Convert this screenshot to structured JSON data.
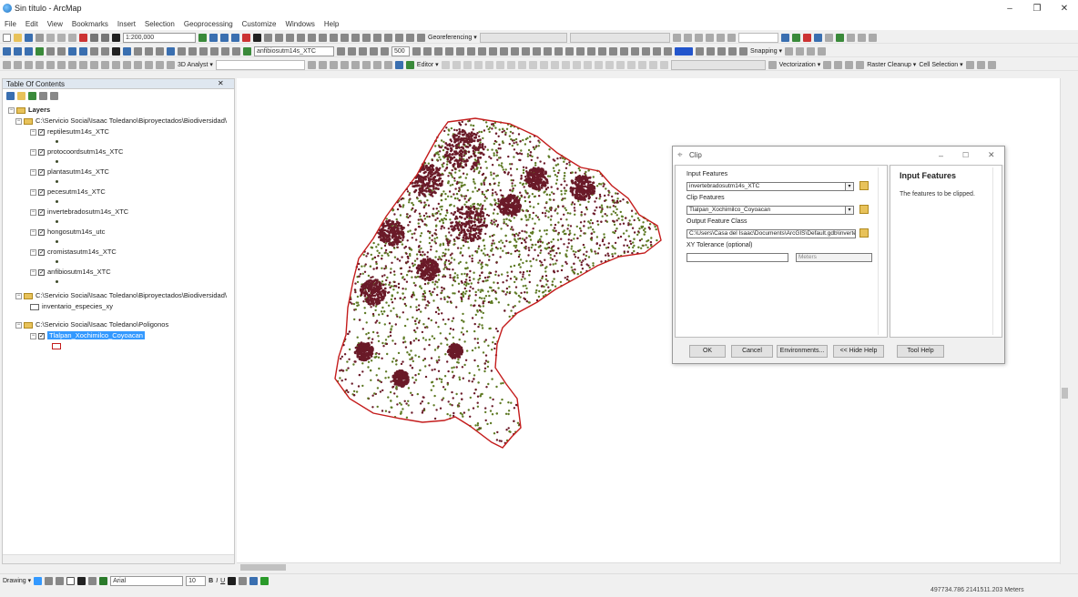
{
  "window": {
    "title": "Sin título - ArcMap",
    "minimize": "–",
    "maximize": "❐",
    "close": "✕"
  },
  "menu": [
    "File",
    "Edit",
    "View",
    "Bookmarks",
    "Insert",
    "Selection",
    "Geoprocessing",
    "Customize",
    "Windows",
    "Help"
  ],
  "toolbar": {
    "scale": "1:200,000",
    "georeferencing": "Georeferencing ▾",
    "layer_combo": "anfibiosutm14s_XTC",
    "pct": "500",
    "snapping": "Snapping ▾",
    "analyst_3d": "3D Analyst ▾",
    "editor": "Editor ▾",
    "vectorization": "Vectorization ▾",
    "raster_cleanup": "Raster Cleanup ▾",
    "cell_selection": "Cell Selection ▾"
  },
  "toc": {
    "title": "Table Of Contents",
    "close": "✕",
    "layers_label": "Layers",
    "folder1": "C:\\Servicio Social\\Isaac Toledano\\Biproyectados\\Biodiversidad\\",
    "layers": [
      "reptilesutm14s_XTC",
      "protocoordsutm14s_XTC",
      "plantasutm14s_XTC",
      "pecesutm14s_XTC",
      "invertebradosutm14s_XTC",
      "hongosutm14s_utc",
      "cromistasutm14s_XTC",
      "anfibiosutm14s_XTC"
    ],
    "folder2": "C:\\Servicio Social\\Isaac Toledano\\Biproyectados\\Biodiversidad\\",
    "folder2_layer": "inventario_especies_xy",
    "folder3": "C:\\Servicio Social\\Isaac Toledano\\Poligonos",
    "selected_layer": "Tlalpan_Xochimilco_Coyoacan"
  },
  "clip": {
    "title": "Clip",
    "input_features_label": "Input Features",
    "input_features_value": "invertebradosutm14s_XTC",
    "clip_features_label": "Clip Features",
    "clip_features_value": "Tlalpan_Xochimilco_Coyoacan",
    "output_label": "Output Feature Class",
    "output_value": "C:\\Users\\Casa del Isaac\\Documents\\ArcGIS\\Default.gdb\\invertebradosutm14s_XTC_Clip",
    "tolerance_label": "XY Tolerance (optional)",
    "tolerance_value": "",
    "tolerance_unit": "Meters",
    "help_title": "Input Features",
    "help_text": "The features to be clipped.",
    "buttons": {
      "ok": "OK",
      "cancel": "Cancel",
      "environments": "Environments...",
      "hide_help": "<< Hide Help",
      "tool_help": "Tool Help"
    },
    "close": "✕"
  },
  "drawing": {
    "label": "Drawing ▾",
    "font": "Arial",
    "size": "10"
  },
  "status": {
    "coords": "497734.786  2141511.203 Meters"
  },
  "colors": {
    "accent": "#3399ff",
    "boundary": "#c41c1c",
    "points_dark": "#6a1a28",
    "points_green": "#5e7a24"
  }
}
